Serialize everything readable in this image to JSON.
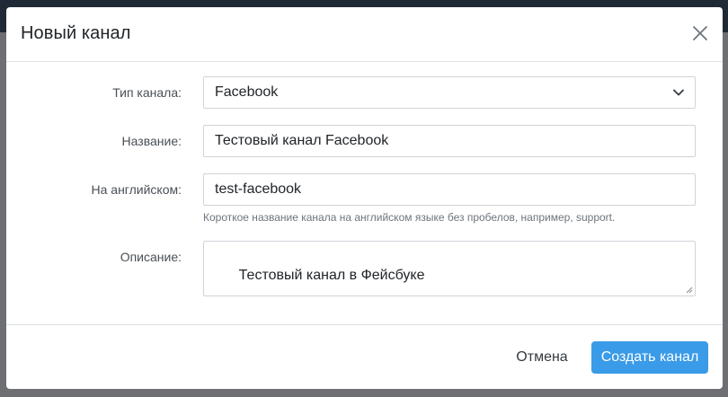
{
  "dialog": {
    "title": "Новый канал",
    "close_icon": "close-icon"
  },
  "form": {
    "channel_type": {
      "label": "Тип канала:",
      "selected": "Facebook"
    },
    "name": {
      "label": "Название:",
      "value": "Тестовый канал Facebook"
    },
    "english_name": {
      "label": "На английском:",
      "value": "test-facebook",
      "help": "Короткое название канала на английском языке без пробелов, например, support."
    },
    "description": {
      "label": "Описание:",
      "value": "Тестовый канал в Фейсбуке"
    }
  },
  "footer": {
    "cancel_label": "Отмена",
    "submit_label": "Создать канал"
  },
  "colors": {
    "primary": "#3a9be8",
    "backdrop": "#6e6f72",
    "border": "#ced4da"
  }
}
